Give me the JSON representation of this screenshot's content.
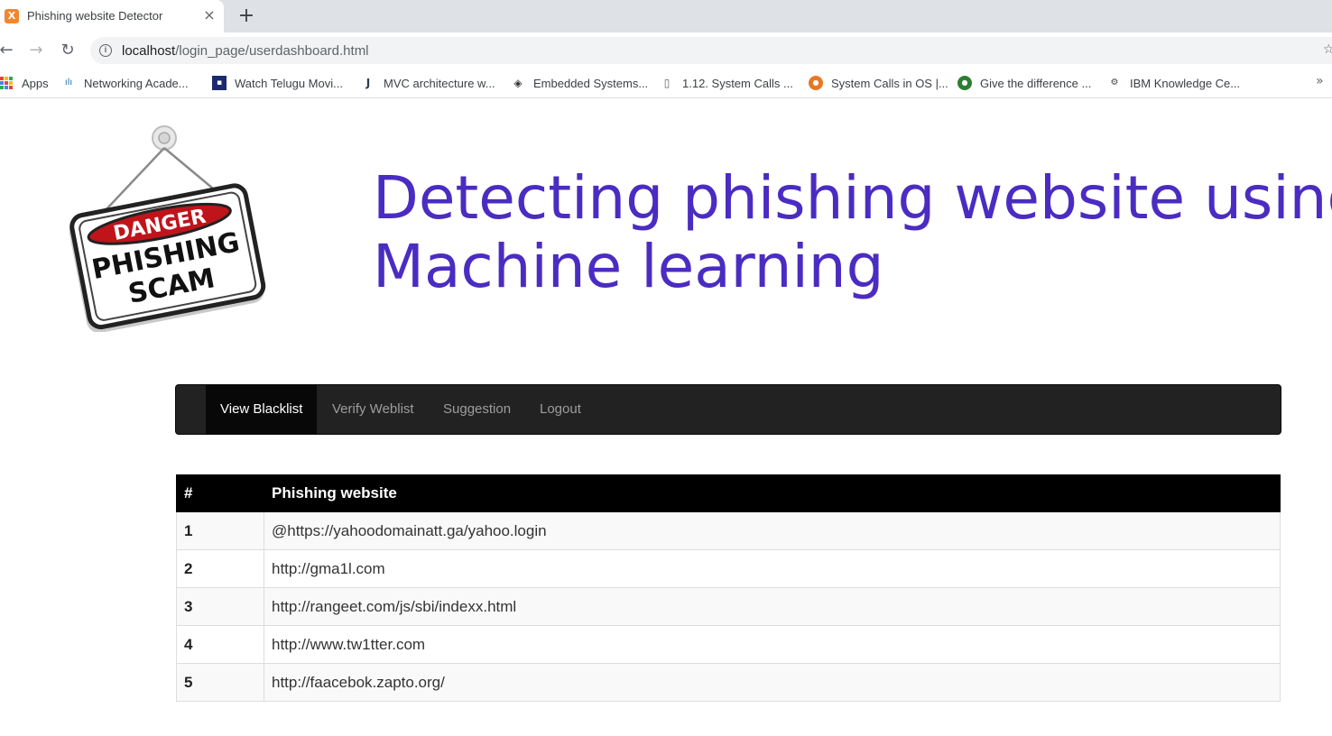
{
  "browser": {
    "tab_title": "Phishing website Detector",
    "tab_close": "×",
    "new_tab": "+",
    "url_host": "localhost",
    "url_path": "/login_page/userdashboard.html",
    "bookmarks": [
      {
        "label": "Apps",
        "icon": "apps-grid-icon"
      },
      {
        "label": "Networking Acade...",
        "icon": "cisco-icon"
      },
      {
        "label": "Watch Telugu Movi...",
        "icon": "movie-icon"
      },
      {
        "label": "MVC architecture w...",
        "icon": "hook-icon"
      },
      {
        "label": "Embedded Systems...",
        "icon": "diamond-icon"
      },
      {
        "label": "1.12. System Calls ...",
        "icon": "page-icon"
      },
      {
        "label": "System Calls in OS |...",
        "icon": "orange-logo-icon"
      },
      {
        "label": "Give the difference ...",
        "icon": "green-logo-icon"
      },
      {
        "label": "IBM Knowledge Ce...",
        "icon": "ibm-icon"
      }
    ],
    "more_bookmarks": "»"
  },
  "logo": {
    "line1": "DANGER",
    "line2": "PHISHING",
    "line3": "SCAM"
  },
  "header": {
    "title_line1": "Detecting phishing website using",
    "title_line2": "Machine learning"
  },
  "nav": {
    "items": [
      "View Blacklist",
      "Verify Weblist",
      "Suggestion",
      "Logout"
    ],
    "active": "View Blacklist"
  },
  "table": {
    "headers": [
      "#",
      "Phishing website"
    ],
    "rows": [
      [
        "1",
        "@https://yahoodomainatt.ga/yahoo.login"
      ],
      [
        "2",
        "http://gma1l.com"
      ],
      [
        "3",
        "http://rangeet.com/js/sbi/indexx.html"
      ],
      [
        "4",
        "http://www.tw1tter.com"
      ],
      [
        "5",
        "http://faacebok.zapto.org/"
      ]
    ]
  },
  "colors": {
    "headline": "#4b2cc2",
    "navbar": "#222222",
    "danger_red": "#c0141b"
  }
}
